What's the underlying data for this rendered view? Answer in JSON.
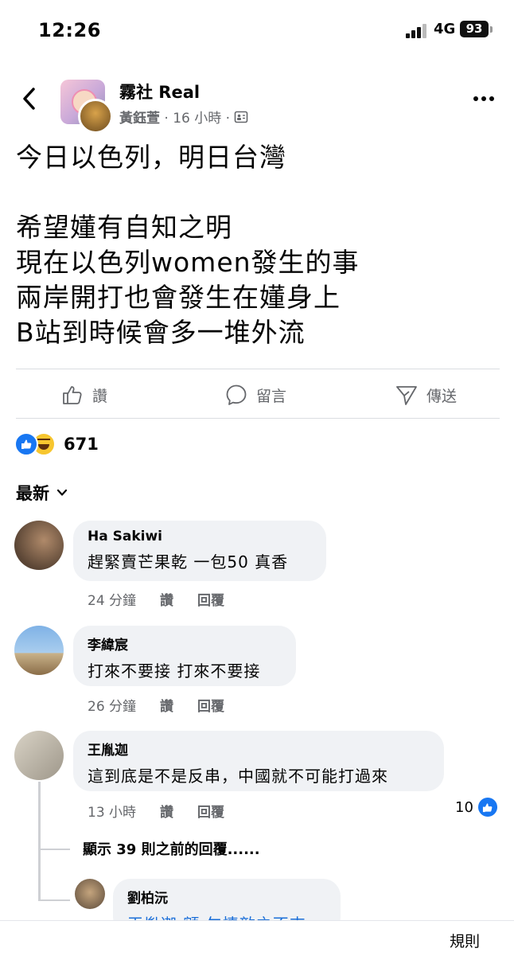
{
  "status_bar": {
    "time": "12:26",
    "network": "4G",
    "battery": "93"
  },
  "header": {
    "page_name": "霧社 Real",
    "author": "黃鈺萱",
    "time": "· 16 小時 ·",
    "back_icon": "chevron-left-icon",
    "more_icon": "more-horizontal-icon",
    "audience_icon": "group-icon"
  },
  "post": {
    "lines": [
      "今日以色列，明日台灣",
      "",
      "希望嬞有自知之明",
      "現在以色列women發生的事",
      "兩岸開打也會發生在嬞身上",
      "B站到時候會多一堆外流"
    ]
  },
  "actions": {
    "like": "讚",
    "comment": "留言",
    "share": "傳送"
  },
  "reactions": {
    "count": "671",
    "types": [
      "like",
      "haha"
    ]
  },
  "sort": {
    "label": "最新"
  },
  "comments": [
    {
      "name": "Ha Sakiwi",
      "text": "趕緊賣芒果乾 一包50 真香",
      "time": "24 分鐘",
      "like": "讚",
      "reply": "回覆"
    },
    {
      "name": "李緯宸",
      "text": "打來不要接 打來不要接",
      "time": "26 分鐘",
      "like": "讚",
      "reply": "回覆"
    },
    {
      "name": "王胤迦",
      "text": "這到底是不是反串，中國就不可能打過來",
      "time": "13 小時",
      "like": "讚",
      "reply": "回覆",
      "likes": "10"
    }
  ],
  "more_replies": "顯示 39 則之前的回覆......",
  "reply": {
    "name": "劉柏沅",
    "text": "王胤迦 額 匆情敵之不來"
  },
  "footer": {
    "rules": "規則"
  },
  "colors": {
    "accent": "#1877f2",
    "secondary_text": "#65676b",
    "bubble": "#f0f2f5"
  }
}
